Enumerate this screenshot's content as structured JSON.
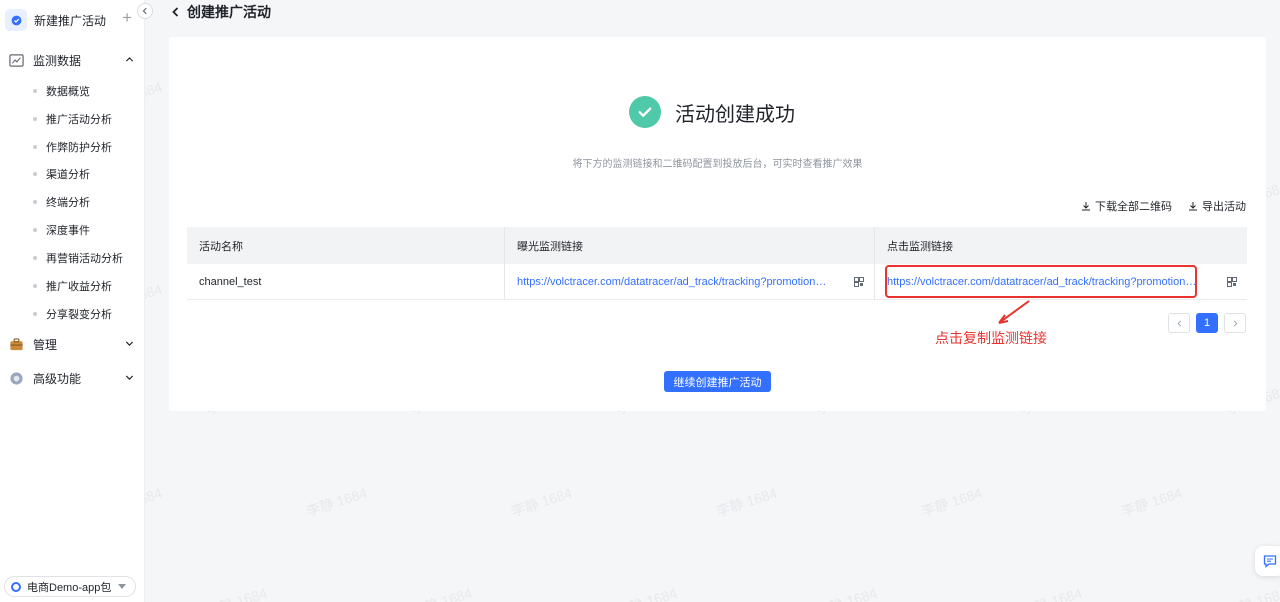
{
  "sidebar": {
    "new_campaign_label": "新建推广活动",
    "groups": {
      "monitoring": "监测数据",
      "management": "管理",
      "advanced": "高级功能"
    },
    "sub_items": [
      "数据概览",
      "推广活动分析",
      "作弊防护分析",
      "渠道分析",
      "终端分析",
      "深度事件",
      "再营销活动分析",
      "推广收益分析",
      "分享裂变分析"
    ],
    "app_selector": "电商Demo-app包"
  },
  "header": {
    "title": "创建推广活动"
  },
  "result": {
    "title": "活动创建成功",
    "subtitle": "将下方的监测链接和二维码配置到投放后台，可实时查看推广效果"
  },
  "actions": {
    "download_qr": "下载全部二维码",
    "export": "导出活动"
  },
  "table": {
    "headers": [
      "活动名称",
      "曝光监测链接",
      "点击监测链接"
    ],
    "rows": [
      {
        "name": "channel_test",
        "impression_link": "https://volctracer.com/datatracer/ad_track/tracking?promotion_ch...",
        "click_link": "https://volctracer.com/datatracer/ad_track/tracking?promotion_ch..."
      }
    ]
  },
  "annotation": "点击复制监测链接",
  "pagination": {
    "current": "1"
  },
  "cta_label": "继续创建推广活动",
  "watermark": "李静 1684",
  "colors": {
    "accent": "#3370ff",
    "success": "#4fc9a8",
    "annotation": "#e8332f"
  }
}
